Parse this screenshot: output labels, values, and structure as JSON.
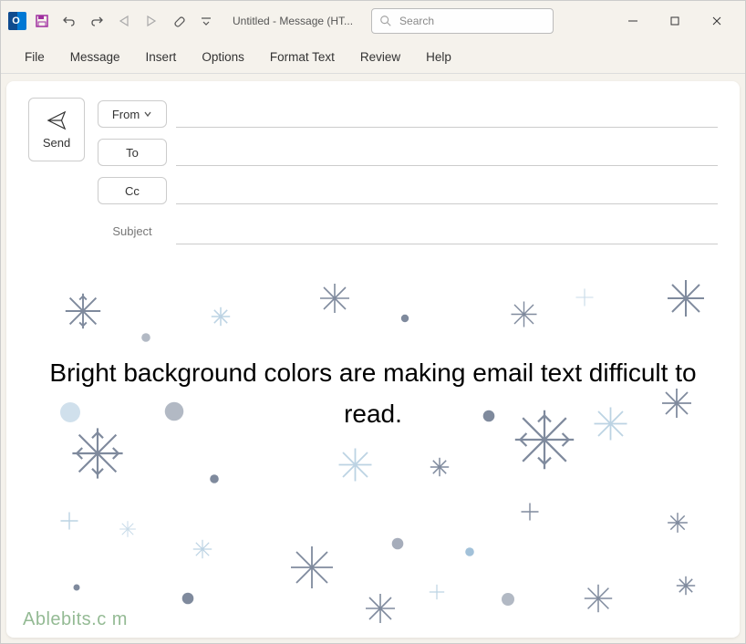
{
  "titlebar": {
    "app_letter": "O",
    "doc_title": "Untitled  -  Message (HT...",
    "search_placeholder": "Search"
  },
  "ribbon": {
    "tabs": [
      "File",
      "Message",
      "Insert",
      "Options",
      "Format Text",
      "Review",
      "Help"
    ]
  },
  "compose": {
    "send_label": "Send",
    "from_label": "From",
    "to_label": "To",
    "cc_label": "Cc",
    "subject_label": "Subject"
  },
  "body": {
    "text": "Bright background colors are making email text difficult to read."
  },
  "watermark": "Ablebits.c    m",
  "colors": {
    "accent": "#0078d4",
    "snowflake_dark": "#4a5a75",
    "snowflake_light": "#7ba8c9"
  }
}
